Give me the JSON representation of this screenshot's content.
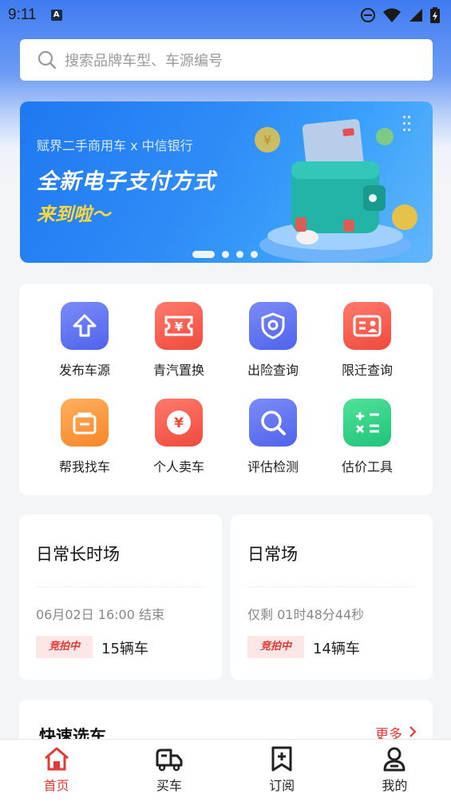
{
  "status_bar": {
    "time": "9:11",
    "notification_badge": "A"
  },
  "search": {
    "placeholder": "搜索品牌车型、车源编号"
  },
  "banner": {
    "subtitle": "赋界二手商用车 x 中信银行",
    "title": "全新电子支付方式",
    "title2": "来到啦～",
    "slide_count": 4,
    "active_slide": 1
  },
  "services": [
    {
      "label": "发布车源",
      "icon": "upload-arrow-icon",
      "color": "#5b6ef0"
    },
    {
      "label": "青汽置换",
      "icon": "ticket-yuan-icon",
      "color": "#f25c4f"
    },
    {
      "label": "出险查询",
      "icon": "shield-icon",
      "color": "#5b6ef0"
    },
    {
      "label": "限迁查询",
      "icon": "id-card-icon",
      "color": "#f25c4f"
    },
    {
      "label": "帮我找车",
      "icon": "bag-icon",
      "color": "#f7902f"
    },
    {
      "label": "个人卖车",
      "icon": "yuan-coin-icon",
      "color": "#f04a3e"
    },
    {
      "label": "评估检测",
      "icon": "magnifier-icon",
      "color": "#5b6ef0"
    },
    {
      "label": "估价工具",
      "icon": "calculator-icon",
      "color": "#2dc97a"
    }
  ],
  "sessions": [
    {
      "title": "日常长时场",
      "time_text": "06月02日 16:00 结束",
      "badge": "竞拍中",
      "count": "15辆车"
    },
    {
      "title": "日常场",
      "time_text": "仅剩 01时48分44秒",
      "badge": "竞拍中",
      "count": "14辆车"
    }
  ],
  "quick_select": {
    "title": "快速选车",
    "more": "更多"
  },
  "tabs": [
    {
      "label": "首页",
      "icon": "home-icon",
      "active": true
    },
    {
      "label": "买车",
      "icon": "truck-icon",
      "active": false
    },
    {
      "label": "订阅",
      "icon": "bookmark-plus-icon",
      "active": false
    },
    {
      "label": "我的",
      "icon": "person-icon",
      "active": false
    }
  ],
  "colors": {
    "accent": "#e53935",
    "blue": "#2f86f4"
  }
}
